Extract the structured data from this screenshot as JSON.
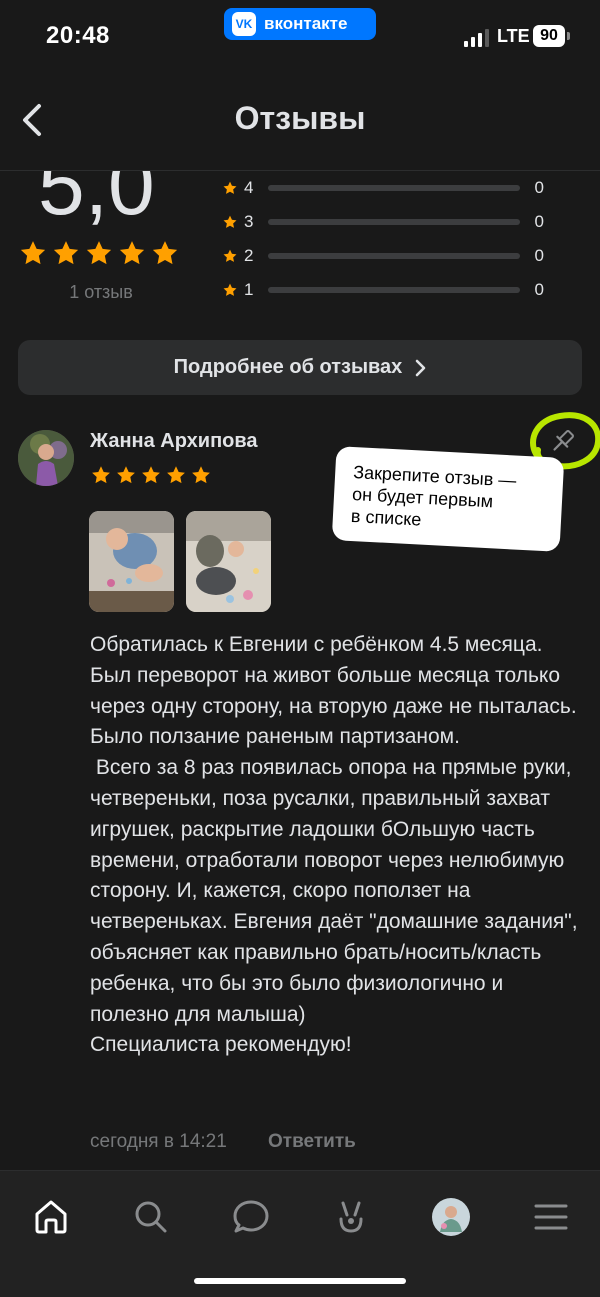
{
  "status_bar": {
    "time": "20:48",
    "app_badge": "вконтакте",
    "app_badge_logo": "VK",
    "network": "LTE",
    "battery": "90"
  },
  "header": {
    "title": "Отзывы",
    "back_icon": "chevron-left-icon"
  },
  "summary": {
    "rating": "5,0",
    "rating_stars": 5,
    "count_label": "1 отзыв",
    "distribution": [
      {
        "stars": "4",
        "count": "0",
        "fraction": 0
      },
      {
        "stars": "3",
        "count": "0",
        "fraction": 0
      },
      {
        "stars": "2",
        "count": "0",
        "fraction": 0
      },
      {
        "stars": "1",
        "count": "0",
        "fraction": 0
      }
    ],
    "more_button": "Подробнее об отзывах"
  },
  "review": {
    "author": "Жанна Архипова",
    "stars": 5,
    "photos": [
      "baby-photo-1",
      "baby-photo-2"
    ],
    "text": "Обратилась к Евгении с ребёнком 4.5 месяца. Был переворот на живот больше месяца только через одну сторону, на вторую даже не пыталась. Было ползание раненым партизаном.\n Всего за 8 раз появилась опора на прямые руки, четвереньки, поза русалки, правильный захват игрушек, раскрытие ладошки бОльшую часть времени, отработали поворот через нелюбимую сторону. И, кажется, скоро поползет на четвереньках. Евгения даёт \"домашние задания\", объясняет как правильно брать/носить/класть ребенка, что бы это было физиологично и полезно для малыша)\nСпециалиста рекомендую!",
    "time": "сегодня в 14:21",
    "reply": "Ответить",
    "pin_icon": "pin-icon"
  },
  "tooltip": {
    "line1": "Закрепите отзыв —",
    "line2": "он будет первым",
    "line3": "в списке"
  },
  "colors": {
    "background": "#191919",
    "star": "#ffa000",
    "accent_badge": "#0077ff",
    "highlight": "#b8e600",
    "secondary_text": "#76787a"
  },
  "nav": [
    "home-icon",
    "search-icon",
    "messages-icon",
    "clips-icon",
    "profile-avatar",
    "menu-icon"
  ]
}
